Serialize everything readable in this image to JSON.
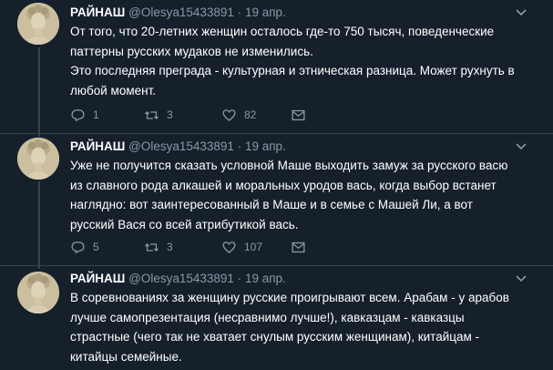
{
  "tweets": [
    {
      "name": "РАЙНАШ",
      "handle": "@Olesya15433891",
      "sep": "·",
      "date": "19 апр.",
      "text_lines": [
        "От того, что 20-летних женщин осталось где-то 750 тысяч, поведенческие",
        "паттерны русских мудаков не изменились.",
        "Это последняя преграда - культурная и этническая разница. Может рухнуть в",
        "любой момент."
      ],
      "replies": "1",
      "retweets": "3",
      "likes": "82"
    },
    {
      "name": "РАЙНАШ",
      "handle": "@Olesya15433891",
      "sep": "·",
      "date": "19 апр.",
      "text_lines": [
        "Уже не получится сказать условной Маше выходить замуж за русского васю",
        "из славного рода алкашей и моральных уродов вась, когда выбор встанет",
        "наглядно: вот заинтересованный в Маше и в семье с Машей Ли, а вот",
        "русский Вася со всей атрибутикой вась."
      ],
      "replies": "5",
      "retweets": "3",
      "likes": "107"
    },
    {
      "name": "РАЙНАШ",
      "handle": "@Olesya15433891",
      "sep": "·",
      "date": "19 апр.",
      "text_lines": [
        "В соревнованиях за женщину русские проигрывают всем. Арабам - у арабов",
        "лучше самопрезентация (несравнимо лучше!), кавказцам - кавказцы",
        "страстные (чего так не хватает снулым русским женщинам), китайцам -",
        "китайцы семейные."
      ]
    }
  ],
  "icons": {
    "reply": "reply-icon",
    "retweet": "retweet-icon",
    "like": "heart-icon",
    "dm": "envelope-icon",
    "more": "chevron-down-icon"
  },
  "colors": {
    "background": "#15202b",
    "text": "#ffffff",
    "secondary": "#8899a6",
    "divider": "#38444d"
  }
}
